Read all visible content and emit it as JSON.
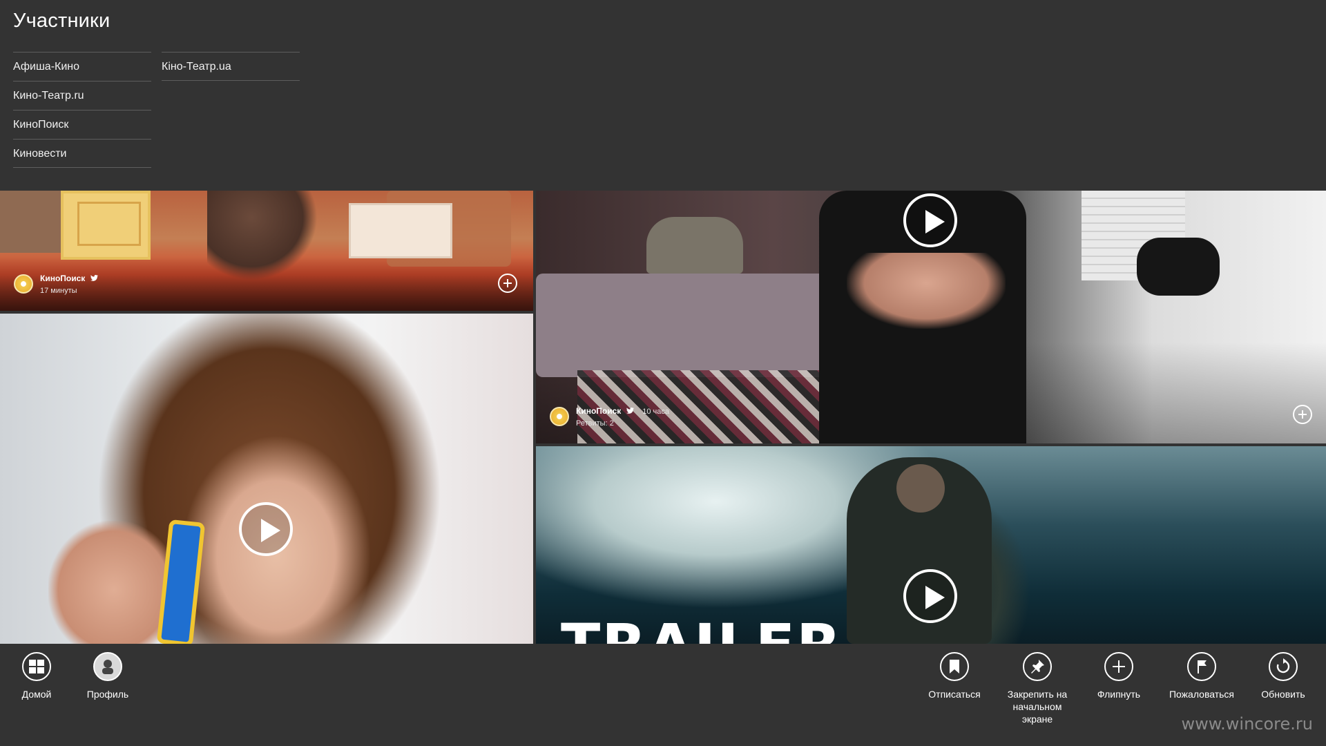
{
  "page": {
    "title": "Участники"
  },
  "members": {
    "column1": [
      "Афиша-Кино",
      "Кино-Театр.ru",
      "КиноПоиск",
      "Киновести"
    ],
    "column2": [
      "Кіно-Театр.ua"
    ]
  },
  "tiles": {
    "stage": {
      "source": "КиноПоиск",
      "time": "17 минуты"
    },
    "host": {
      "source": "КиноПоиск",
      "time": "10 часа",
      "retweets": "Ретвиты: 2"
    },
    "trailer": {
      "caption": "TRAILER"
    }
  },
  "appbar": {
    "home": "Домой",
    "profile": "Профиль",
    "unsubscribe": "Отписаться",
    "pin": "Закрепить на начальном экране",
    "flip": "Флипнуть",
    "report": "Пожаловаться",
    "refresh": "Обновить"
  },
  "watermark": "www.wincore.ru",
  "colors": {
    "background": "#333333",
    "text": "#ffffff",
    "divider": "#5e5e5e"
  }
}
